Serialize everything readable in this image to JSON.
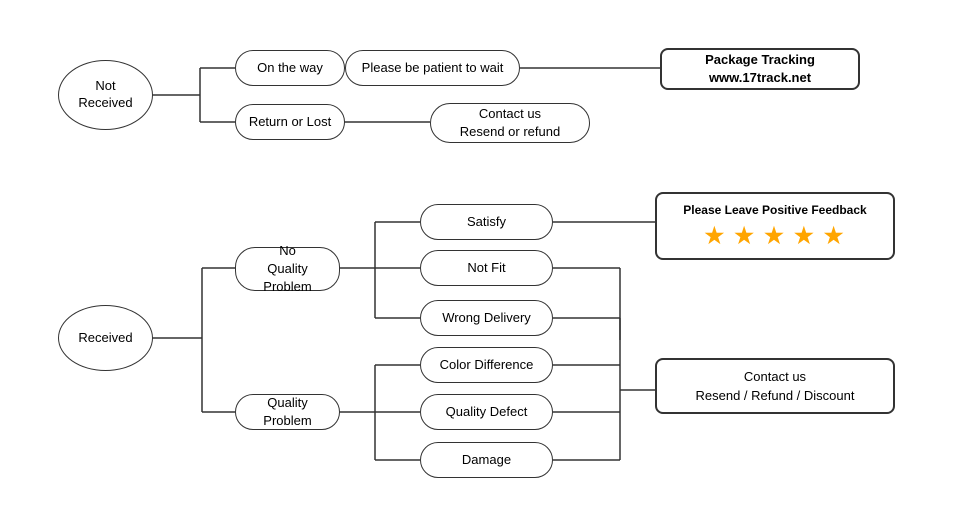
{
  "nodes": {
    "not_received": {
      "label": "Not\nReceived"
    },
    "received": {
      "label": "Received"
    },
    "on_the_way": {
      "label": "On the way"
    },
    "return_or_lost": {
      "label": "Return or Lost"
    },
    "please_patient": {
      "label": "Please be patient to wait"
    },
    "contact_resend_refund": {
      "label": "Contact us\nResend or refund"
    },
    "package_tracking": {
      "label": "Package Tracking\nwww.17track.net"
    },
    "no_quality_problem": {
      "label": "No\nQuality Problem"
    },
    "quality_problem": {
      "label": "Quality Problem"
    },
    "satisfy": {
      "label": "Satisfy"
    },
    "not_fit": {
      "label": "Not Fit"
    },
    "wrong_delivery": {
      "label": "Wrong Delivery"
    },
    "color_difference": {
      "label": "Color Difference"
    },
    "quality_defect": {
      "label": "Quality Defect"
    },
    "damage": {
      "label": "Damage"
    },
    "please_leave_feedback": {
      "label": "Please Leave Positive Feedback"
    },
    "stars": {
      "label": "★ ★ ★ ★ ★"
    },
    "contact_resend_refund_discount": {
      "label": "Contact us\nResend / Refund / Discount"
    }
  }
}
